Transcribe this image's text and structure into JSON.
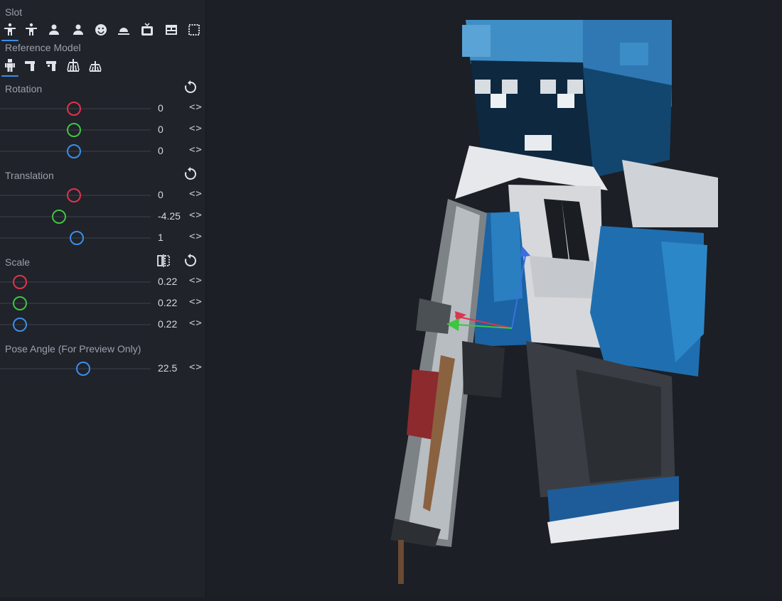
{
  "slot": {
    "label": "Slot",
    "icons": [
      "first-person-right-hand-icon",
      "first-person-left-hand-icon",
      "third-person-right-icon",
      "third-person-left-icon",
      "head-icon",
      "ground-icon",
      "frame-icon",
      "gui-icon",
      "fixed-icon"
    ]
  },
  "reference_model": {
    "label": "Reference Model",
    "icons": [
      "player-model-icon",
      "right-arm-icon",
      "left-arm-icon",
      "armor-stand-icon",
      "armor-stand-small-icon"
    ]
  },
  "rotation": {
    "label": "Rotation",
    "values": [
      "0",
      "0",
      "0"
    ],
    "levels": [
      0.49,
      0.49,
      0.49
    ]
  },
  "translation": {
    "label": "Translation",
    "values": [
      "0",
      "-4.25",
      "1"
    ],
    "levels": [
      0.49,
      0.39,
      0.51
    ]
  },
  "scale": {
    "label": "Scale",
    "values": [
      "0.22",
      "0.22",
      "0.22"
    ],
    "levels": [
      0.13,
      0.13,
      0.13
    ]
  },
  "pose_angle": {
    "label": "Pose Angle (For Preview Only)",
    "value": "22.5",
    "level": 0.55
  },
  "arrows_glyph": "<>",
  "colors": {
    "x_axis": "#e0334d",
    "y_axis": "#3fc53f",
    "z_axis": "#3b8eea",
    "panel_bg": "#20232a",
    "viewport_bg": "#1c1f25"
  }
}
